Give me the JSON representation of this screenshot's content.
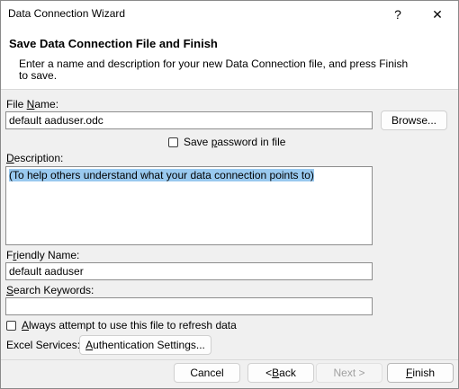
{
  "window": {
    "title": "Data Connection Wizard",
    "help_glyph": "?",
    "close_glyph": "✕"
  },
  "header": {
    "title": "Save Data Connection File and Finish",
    "description": "Enter a name and description for your new Data Connection file, and press Finish to save."
  },
  "file_name": {
    "label_pre": "File ",
    "label_key": "N",
    "label_post": "ame:",
    "value": "default aaduser.odc"
  },
  "browse_label": "Browse...",
  "save_password": {
    "label_pre": "Save ",
    "label_key": "p",
    "label_post": "assword in file",
    "checked": false
  },
  "description": {
    "label_key": "D",
    "label_post": "escription:",
    "value": "(To help others understand what your data connection points to)"
  },
  "friendly_name": {
    "label_pre": "F",
    "label_key": "r",
    "label_post": "iendly Name:",
    "value": "default aaduser"
  },
  "search_keywords": {
    "label_key": "S",
    "label_post": "earch Keywords:",
    "value": ""
  },
  "always_refresh": {
    "label_key": "A",
    "label_post": "lways attempt to use this file to refresh data",
    "checked": false
  },
  "excel_services": {
    "label": "Excel Services:",
    "auth_key": "A",
    "auth_post": "uthentication Settings..."
  },
  "buttons": {
    "cancel": "Cancel",
    "back_pre": "< ",
    "back_key": "B",
    "back_post": "ack",
    "next": "Next >",
    "finish_key": "F",
    "finish_post": "inish"
  }
}
